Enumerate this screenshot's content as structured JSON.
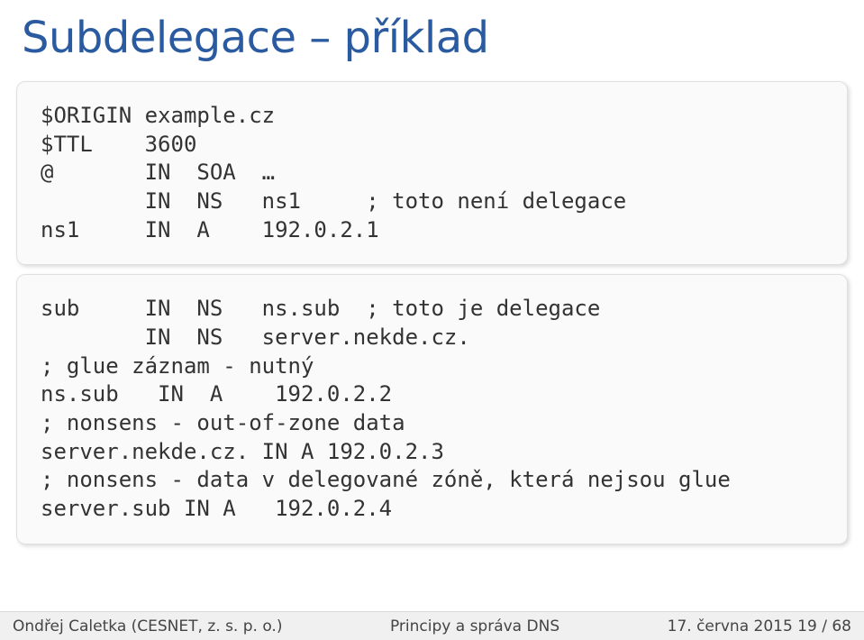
{
  "title": "Subdelegace – příklad",
  "block1": {
    "l1": "$ORIGIN example.cz",
    "l2": "$TTL    3600",
    "l3": "@       IN  SOA  …",
    "l4": "        IN  NS   ns1     ; toto není delegace",
    "l5": "ns1     IN  A    192.0.2.1"
  },
  "block2": {
    "l1": "sub     IN  NS   ns.sub  ; toto je delegace",
    "l2": "        IN  NS   server.nekde.cz.",
    "l3": "; glue záznam - nutný",
    "l4": "ns.sub   IN  A    192.0.2.2",
    "l5": "; nonsens - out-of-zone data",
    "l6": "server.nekde.cz. IN A 192.0.2.3",
    "l7": "; nonsens - data v delegované zóně, která nejsou glue",
    "l8": "server.sub IN A   192.0.2.4"
  },
  "footer": {
    "author": "Ondřej Caletka (CESNET, z. s. p. o.)",
    "center": "Principy a správa DNS",
    "right": "17. června 2015      19 / 68"
  }
}
